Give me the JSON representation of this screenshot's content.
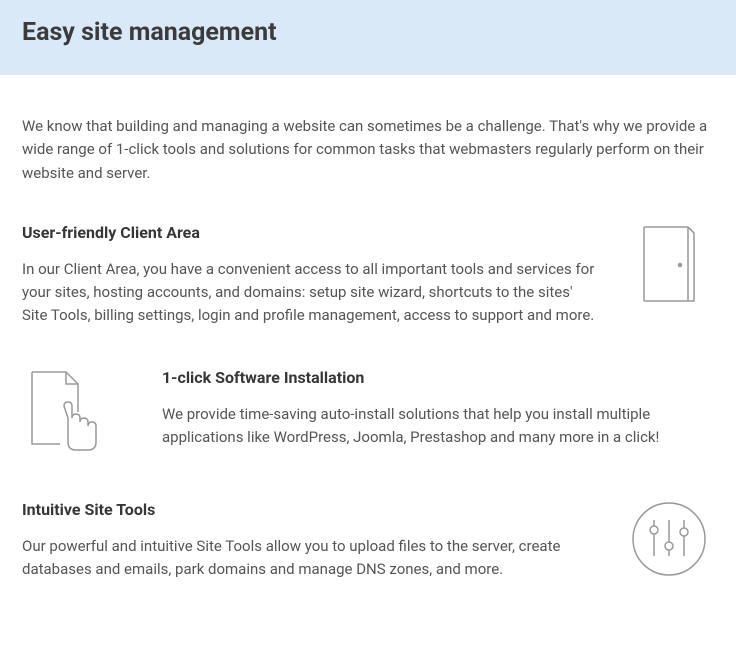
{
  "header": {
    "title": "Easy site management"
  },
  "intro": "We know that building and managing a website can sometimes be a challenge. That's why we provide a wide range of 1-click tools and solutions for common tasks that webmasters regularly perform on their website and server.",
  "sections": [
    {
      "title": "User-friendly Client Area",
      "body": "In our Client Area, you have a convenient access to all important tools and services for your sites, hosting accounts, and domains: setup site wizard, shortcuts to the sites' Site Tools, billing settings, login and profile management, access to support and more."
    },
    {
      "title": "1-click Software Installation",
      "body": "We provide time-saving auto-install solutions that help you install multiple applications like WordPress, Joomla, Prestashop and many more in a click!"
    },
    {
      "title": "Intuitive Site Tools",
      "body": "Our powerful and intuitive Site Tools allow you to upload files to the server, create databases and emails, park domains and manage DNS zones, and more."
    }
  ]
}
